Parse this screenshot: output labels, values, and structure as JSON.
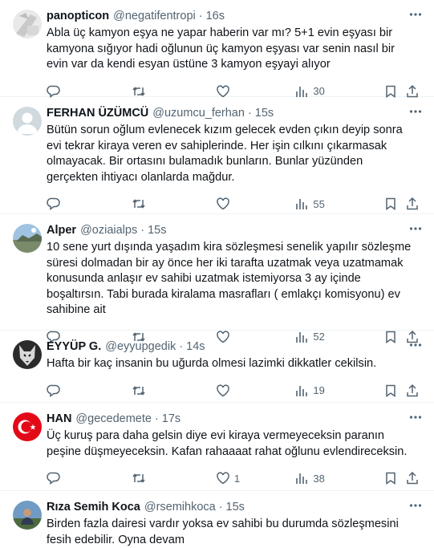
{
  "tweets": [
    {
      "name": "panopticon",
      "handle": "@negatifentropi",
      "time": "16s",
      "text": "Abla üç kamyon eşya ne yapar haberin var mı? 5+1 evin eşyası bir kamyona sığıyor hadi oğlunun üç kamyon eşyası var senin nasıl bir evin var da kendi esyan üstüne 3 kamyon eşyayi alıyor",
      "replies": "",
      "retweets": "",
      "likes": "",
      "views": "30"
    },
    {
      "name": "FERHAN ÜZÜMCÜ",
      "handle": "@uzumcu_ferhan",
      "time": "15s",
      "text": "Bütün sorun oğlum evlenecek kızım gelecek evden çıkın deyip sonra evi tekrar kiraya veren ev sahiplerinde. Her işin cılkını çıkarmasak olmayacak. Bir ortasını bulamadık bunların. Bunlar yüzünden gerçekten ihtiyacı olanlarda mağdur.",
      "replies": "",
      "retweets": "",
      "likes": "",
      "views": "55"
    },
    {
      "name": "Alper",
      "handle": "@oziaialps",
      "time": "15s",
      "text": "10 sene yurt dışında yaşadım kira sözleşmesi senelik yapılır sözleşme süresi dolmadan bir ay önce her iki tarafta uzatmak veya uzatmamak konusunda anlaşır ev sahibi uzatmak istemiyorsa 3 ay içinde boşaltırsın. Tabi burada kiralama masrafları ( emlakçı komisyonu) ev sahibine ait",
      "replies": "",
      "retweets": "",
      "likes": "",
      "views": "52"
    },
    {
      "name": "EYYÜP G.",
      "handle": "@eyyupgedik",
      "time": "14s",
      "text": "Hafta bir kaç insanin bu uğurda olmesi lazimki dikkatler cekilsin.",
      "replies": "",
      "retweets": "",
      "likes": "",
      "views": "19"
    },
    {
      "name": "HAN",
      "handle": "@gecedemete",
      "time": "17s",
      "text": "Üç kuruş para daha gelsin diye evi kiraya vermeyeceksin paranın peşine düşmeyeceksin. Kafan rahaaaat rahat oğlunu evlendireceksin.",
      "replies": "",
      "retweets": "",
      "likes": "1",
      "views": "38"
    },
    {
      "name": "Rıza Semih Koca",
      "handle": "@rsemihkoca",
      "time": "15s",
      "text": "Birden fazla dairesi vardır yoksa ev sahibi bu durumda sözleşmesini fesih edebilir. Oyna devam",
      "replies": "",
      "retweets": "",
      "likes": "",
      "views": ""
    }
  ],
  "icons": {
    "reply": "reply-icon",
    "retweet": "retweet-icon",
    "like": "heart-icon",
    "views": "views-chart-icon",
    "bookmark": "bookmark-icon",
    "share": "share-icon",
    "more": "more-dots-icon"
  },
  "colors": {
    "text": "#0f1419",
    "secondary": "#536471",
    "divider": "#eff3f4"
  }
}
